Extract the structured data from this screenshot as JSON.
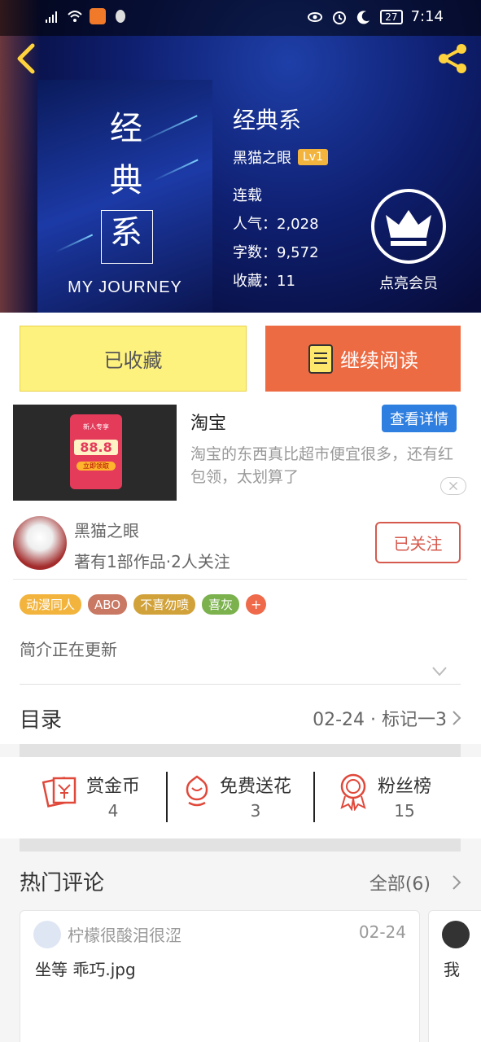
{
  "status_bar": {
    "time": "7:14",
    "battery": "27",
    "icons": [
      "signal-icon",
      "wifi-icon",
      "video-app-icon",
      "qq-icon",
      "eye-icon",
      "alarm-icon",
      "moon-icon",
      "battery-icon"
    ]
  },
  "header": {
    "back_icon": "chevron-left-icon",
    "share_icon": "share-icon"
  },
  "cover": {
    "chars": [
      "经",
      "典",
      "系"
    ],
    "subtitle": "MY JOURNEY"
  },
  "book": {
    "title": "经典系",
    "author": "黑猫之眼",
    "level": "Lv1",
    "status": "连载",
    "popularity": "人气：2,028",
    "word_count": "字数：9,572",
    "favorites": "收藏：11"
  },
  "vip": {
    "label": "点亮会员",
    "icon": "crown-icon"
  },
  "actions": {
    "favorited_label": "已收藏",
    "continue_label": "继续阅读",
    "colors": {
      "favorited_bg": "#fef27f",
      "continue_bg": "#ec6b43"
    }
  },
  "ad": {
    "title": "淘宝",
    "button": "查看详情",
    "description": "淘宝的东西真比超市便宜很多，还有红包领，太划算了",
    "badge_top": "新人专享",
    "badge_amount": "88.8",
    "badge_button": "立即领取"
  },
  "author_card": {
    "name": "黑猫之眼",
    "subtitle": "著有1部作品·2人关注",
    "follow_label": "已关注"
  },
  "tags": [
    {
      "label": "动漫同人",
      "color": "#f3b43d"
    },
    {
      "label": "ABO",
      "color": "#c97863"
    },
    {
      "label": "不喜勿喷",
      "color": "#d2a23a"
    },
    {
      "label": "喜灰",
      "color": "#7bb24e"
    }
  ],
  "tag_add": "+",
  "intro": "简介正在更新",
  "toc": {
    "title": "目录",
    "latest": "02-24 · 标记一3"
  },
  "stats": [
    {
      "label": "赏金币",
      "value": "4",
      "icon": "red-envelope-icon"
    },
    {
      "label": "免费送花",
      "value": "3",
      "icon": "flower-icon"
    },
    {
      "label": "粉丝榜",
      "value": "15",
      "icon": "medal-icon"
    }
  ],
  "comments": {
    "title": "热门评论",
    "all_label": "全部(6)",
    "items": [
      {
        "user": "柠檬很酸泪很涩",
        "date": "02-24",
        "text": "坐等 乖巧.jpg"
      },
      {
        "text": "我"
      }
    ]
  }
}
